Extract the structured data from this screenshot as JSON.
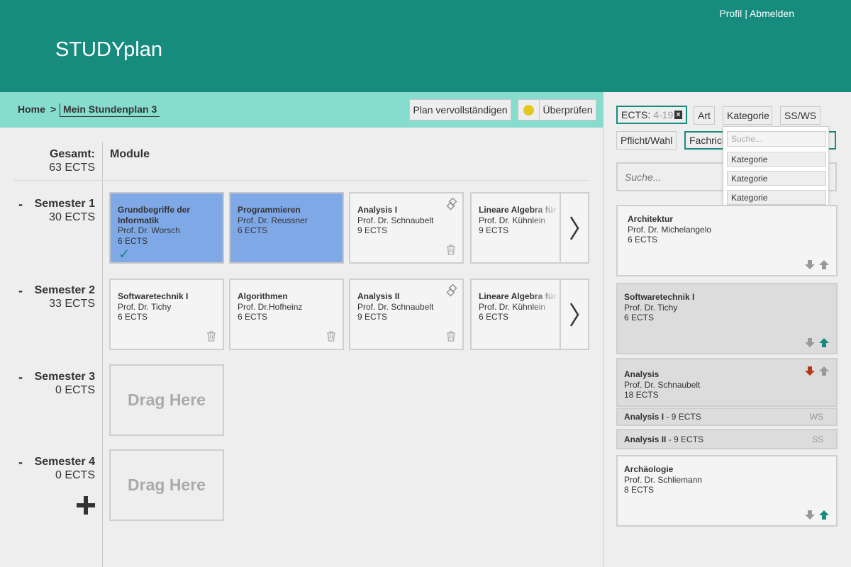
{
  "app": {
    "title": "STUDYplan",
    "profile": "Profil",
    "sep": "|",
    "logout": "Abmelden"
  },
  "breadcrumb": {
    "home": "Home",
    "sep": ">",
    "current": "Mein Stundenplan 3"
  },
  "toolbar": {
    "complete": "Plan vervollständigen",
    "check": "Überprüfen",
    "status_color": "#e4c81e"
  },
  "summary": {
    "total_label": "Gesamt:",
    "total_value": "63 ECTS",
    "modules_label": "Module"
  },
  "semesters": [
    {
      "label": "Semester 1",
      "ects": "30 ECTS",
      "minus": "-",
      "modules": [
        {
          "title": "Grundbegriffe der Informatik",
          "prof": "Prof. Dr. Worsch",
          "ects": "6 ECTS",
          "checkmark": "✓"
        },
        {
          "title": "Programmieren",
          "prof": "Prof. Dr. Reussner",
          "ects": "6 ECTS"
        },
        {
          "title": "Analysis I",
          "prof": "Prof. Dr. Schnaubelt",
          "ects": "9 ECTS"
        },
        {
          "title": "Lineare Algebra für Fachrichtung Informatik",
          "prof": "Prof. Dr. Kühnlein",
          "ects": "9 ECTS"
        }
      ]
    },
    {
      "label": "Semester 2",
      "ects": "33 ECTS",
      "minus": "-",
      "modules": [
        {
          "title": "Softwaretechnik I",
          "prof": "Prof. Dr. Tichy",
          "ects": "6 ECTS"
        },
        {
          "title": "Algorithmen",
          "prof": "Prof. Dr.Hofheinz",
          "ects": "6 ECTS"
        },
        {
          "title": "Analysis II",
          "prof": "Prof. Dr. Schnaubelt",
          "ects": "9 ECTS"
        },
        {
          "title": "Lineare Algebra für Fachrichtung Informatik",
          "prof": "Prof. Dr. Kühnlein",
          "ects": "6 ECTS"
        }
      ]
    },
    {
      "label": "Semester 3",
      "ects": "0 ECTS",
      "minus": "-",
      "dropzone": "Drag Here"
    },
    {
      "label": "Semester 4",
      "ects": "0 ECTS",
      "minus": "-",
      "dropzone": "Drag Here"
    }
  ],
  "filters": {
    "ects_label": "ECTS:",
    "ects_range": "4-19",
    "ects_clear": "×",
    "art": "Art",
    "kategorie": "Kategorie",
    "ssws": "SS/WS",
    "pflicht": "Pflicht/Wahl",
    "fachrichtung": "Fachrichtung"
  },
  "search": {
    "placeholder": "Suche..."
  },
  "dropdown": {
    "search_placeholder": "Suche...",
    "items": [
      "Kategorie",
      "Kategorie",
      "Kategorie"
    ]
  },
  "catalog": [
    {
      "title": "Architektur",
      "prof": "Prof. Dr. Michelangelo",
      "ects": "6 ECTS"
    },
    {
      "title": "Softwaretechnik I",
      "prof": "Prof. Dr. Tichy",
      "ects": "6 ECTS"
    },
    {
      "title": "Analysis",
      "prof": "Prof. Dr. Schnaubelt",
      "ects": "18 ECTS",
      "parts": [
        {
          "name": "Analysis I",
          "ects": "- 9 ECTS",
          "term": "WS"
        },
        {
          "name": "Analysis II",
          "ects": "- 9 ECTS",
          "term": "SS"
        }
      ]
    },
    {
      "title": "Archäologie",
      "prof": "Prof. Dr. Schliemann",
      "ects": "8 ECTS"
    }
  ],
  "colors": {
    "brand": "#168b7e",
    "subbar": "#86dccd",
    "selected_module": "#7fa8e6",
    "arrow_active_up": "#168b7e",
    "arrow_active_down": "#b03a1a",
    "arrow_inactive": "#999999"
  }
}
